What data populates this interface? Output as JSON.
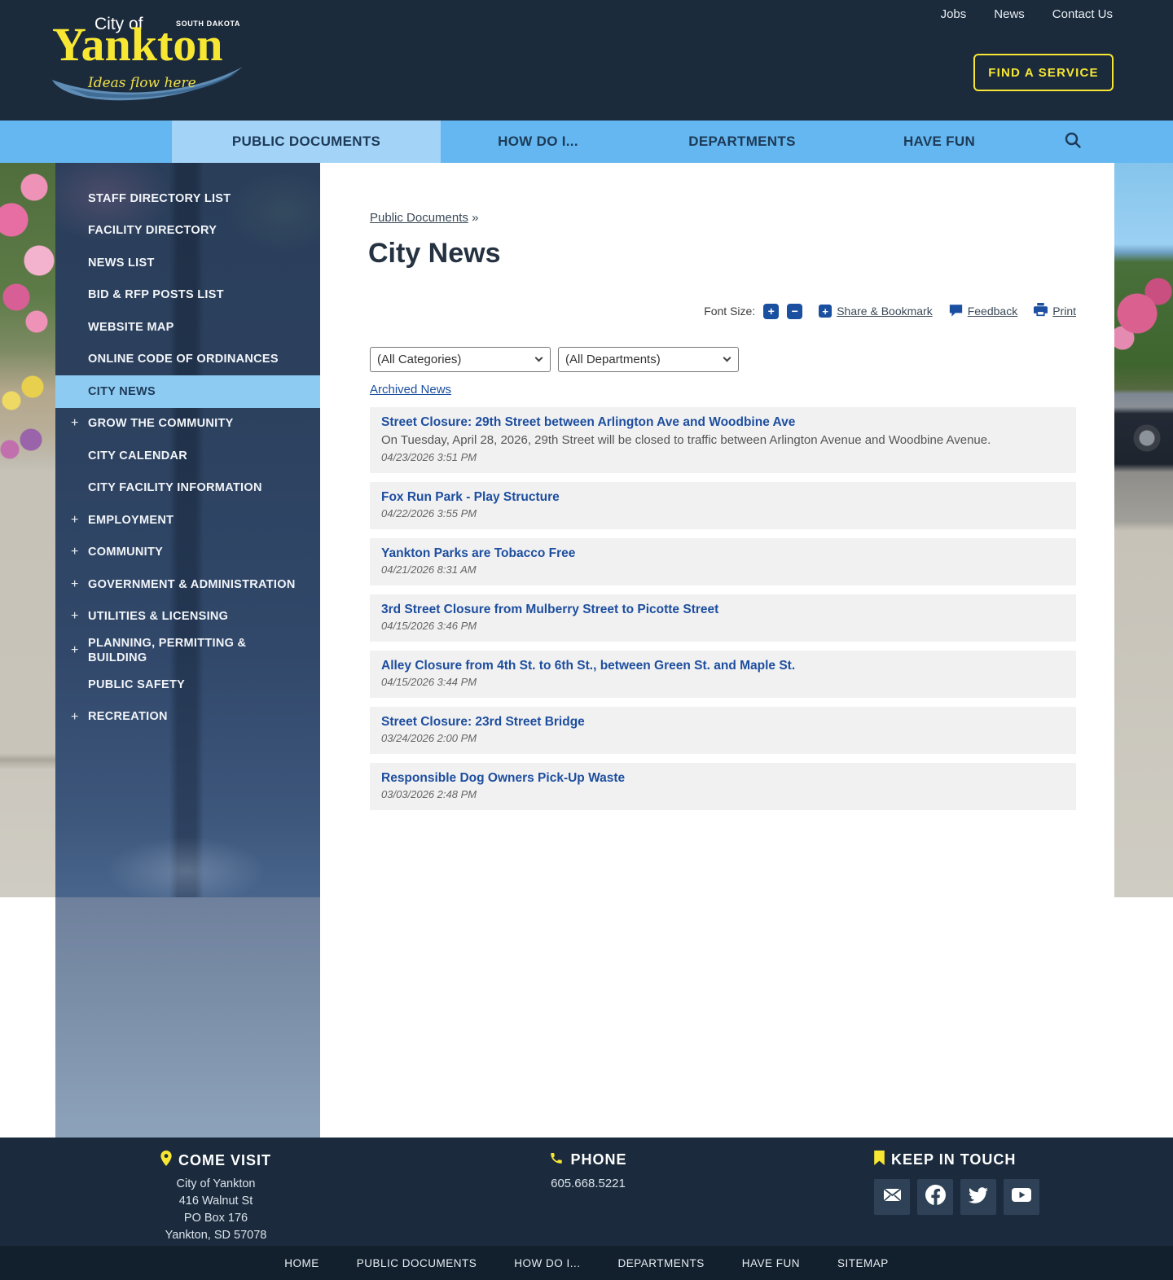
{
  "colors": {
    "header_navy": "#1c2b3c",
    "nav_blue": "#64b7f0",
    "nav_active_blue": "#a3d4f8",
    "accent_yellow": "#f7e733",
    "link_blue": "#1b4fa0",
    "sidebar_active_blue": "#8ecbf2"
  },
  "header": {
    "logo": {
      "city_of": "City of",
      "name": "Yankton",
      "state": "SOUTH DAKOTA",
      "tagline": "Ideas flow here"
    },
    "top_links": [
      {
        "label": "Jobs"
      },
      {
        "label": "News"
      },
      {
        "label": "Contact Us"
      }
    ],
    "find_service_label": "FIND A SERVICE"
  },
  "navbar": {
    "tabs": [
      {
        "label": "PUBLIC DOCUMENTS",
        "active": true
      },
      {
        "label": "HOW DO I...",
        "active": false
      },
      {
        "label": "DEPARTMENTS",
        "active": false
      },
      {
        "label": "HAVE FUN",
        "active": false
      }
    ]
  },
  "sidebar": {
    "expand_glyph": "+",
    "items": [
      {
        "label": "STAFF DIRECTORY LIST"
      },
      {
        "label": "FACILITY DIRECTORY"
      },
      {
        "label": "NEWS LIST"
      },
      {
        "label": "BID & RFP POSTS LIST"
      },
      {
        "label": "WEBSITE MAP"
      },
      {
        "label": "ONLINE CODE OF ORDINANCES"
      },
      {
        "label": "CITY NEWS",
        "active": true
      },
      {
        "label": "GROW THE COMMUNITY",
        "expandable": true
      },
      {
        "label": "CITY CALENDAR"
      },
      {
        "label": "CITY FACILITY INFORMATION"
      },
      {
        "label": "EMPLOYMENT",
        "expandable": true
      },
      {
        "label": "COMMUNITY",
        "expandable": true
      },
      {
        "label": "GOVERNMENT & ADMINISTRATION",
        "expandable": true
      },
      {
        "label": "UTILITIES & LICENSING",
        "expandable": true
      },
      {
        "label": "PLANNING, PERMITTING & BUILDING",
        "expandable": true
      },
      {
        "label": "PUBLIC SAFETY"
      },
      {
        "label": "RECREATION",
        "expandable": true
      }
    ]
  },
  "main": {
    "breadcrumb": {
      "link": "Public Documents",
      "separator": "»"
    },
    "title": "City News",
    "tools": {
      "font_size_label": "Font Size:",
      "increase": "+",
      "decrease": "−",
      "share_icon_glyph": "+",
      "share_label": "Share & Bookmark",
      "feedback_label": "Feedback",
      "print_label": "Print"
    },
    "filters": {
      "categories": "(All Categories)",
      "departments": "(All Departments)"
    },
    "archived_link": "Archived News",
    "news": [
      {
        "title": "Street Closure: 29th Street between Arlington Ave and Woodbine Ave",
        "description": "On Tuesday, April 28, 2026, 29th Street will be closed to traffic between Arlington Avenue and Woodbine Avenue.",
        "date": "04/23/2026 3:51 PM"
      },
      {
        "title": "Fox Run Park - Play Structure",
        "date": "04/22/2026 3:55 PM"
      },
      {
        "title": "Yankton Parks are Tobacco Free",
        "date": "04/21/2026 8:31 AM"
      },
      {
        "title": "3rd Street Closure from Mulberry Street to Picotte Street",
        "date": "04/15/2026 3:46 PM"
      },
      {
        "title": "Alley Closure from 4th St. to 6th St., between Green St. and Maple St.",
        "date": "04/15/2026 3:44 PM"
      },
      {
        "title": "Street Closure: 23rd Street Bridge",
        "date": "03/24/2026 2:00 PM"
      },
      {
        "title": "Responsible Dog Owners Pick-Up Waste",
        "date": "03/03/2026 2:48 PM"
      }
    ]
  },
  "footer": {
    "come_visit": {
      "heading": "COME VISIT",
      "line1": "City of Yankton",
      "line2": "416 Walnut St",
      "line3": "PO Box 176",
      "line4": "Yankton, SD 57078"
    },
    "phone": {
      "heading": "PHONE",
      "number": "605.668.5221"
    },
    "keep_in_touch": {
      "heading": "KEEP IN TOUCH",
      "icons": [
        "email-icon",
        "facebook-icon",
        "twitter-icon",
        "youtube-icon"
      ]
    },
    "bottom_nav": [
      {
        "label": "HOME"
      },
      {
        "label": "PUBLIC DOCUMENTS"
      },
      {
        "label": "HOW DO I..."
      },
      {
        "label": "DEPARTMENTS"
      },
      {
        "label": "HAVE FUN"
      },
      {
        "label": "SITEMAP"
      }
    ]
  }
}
